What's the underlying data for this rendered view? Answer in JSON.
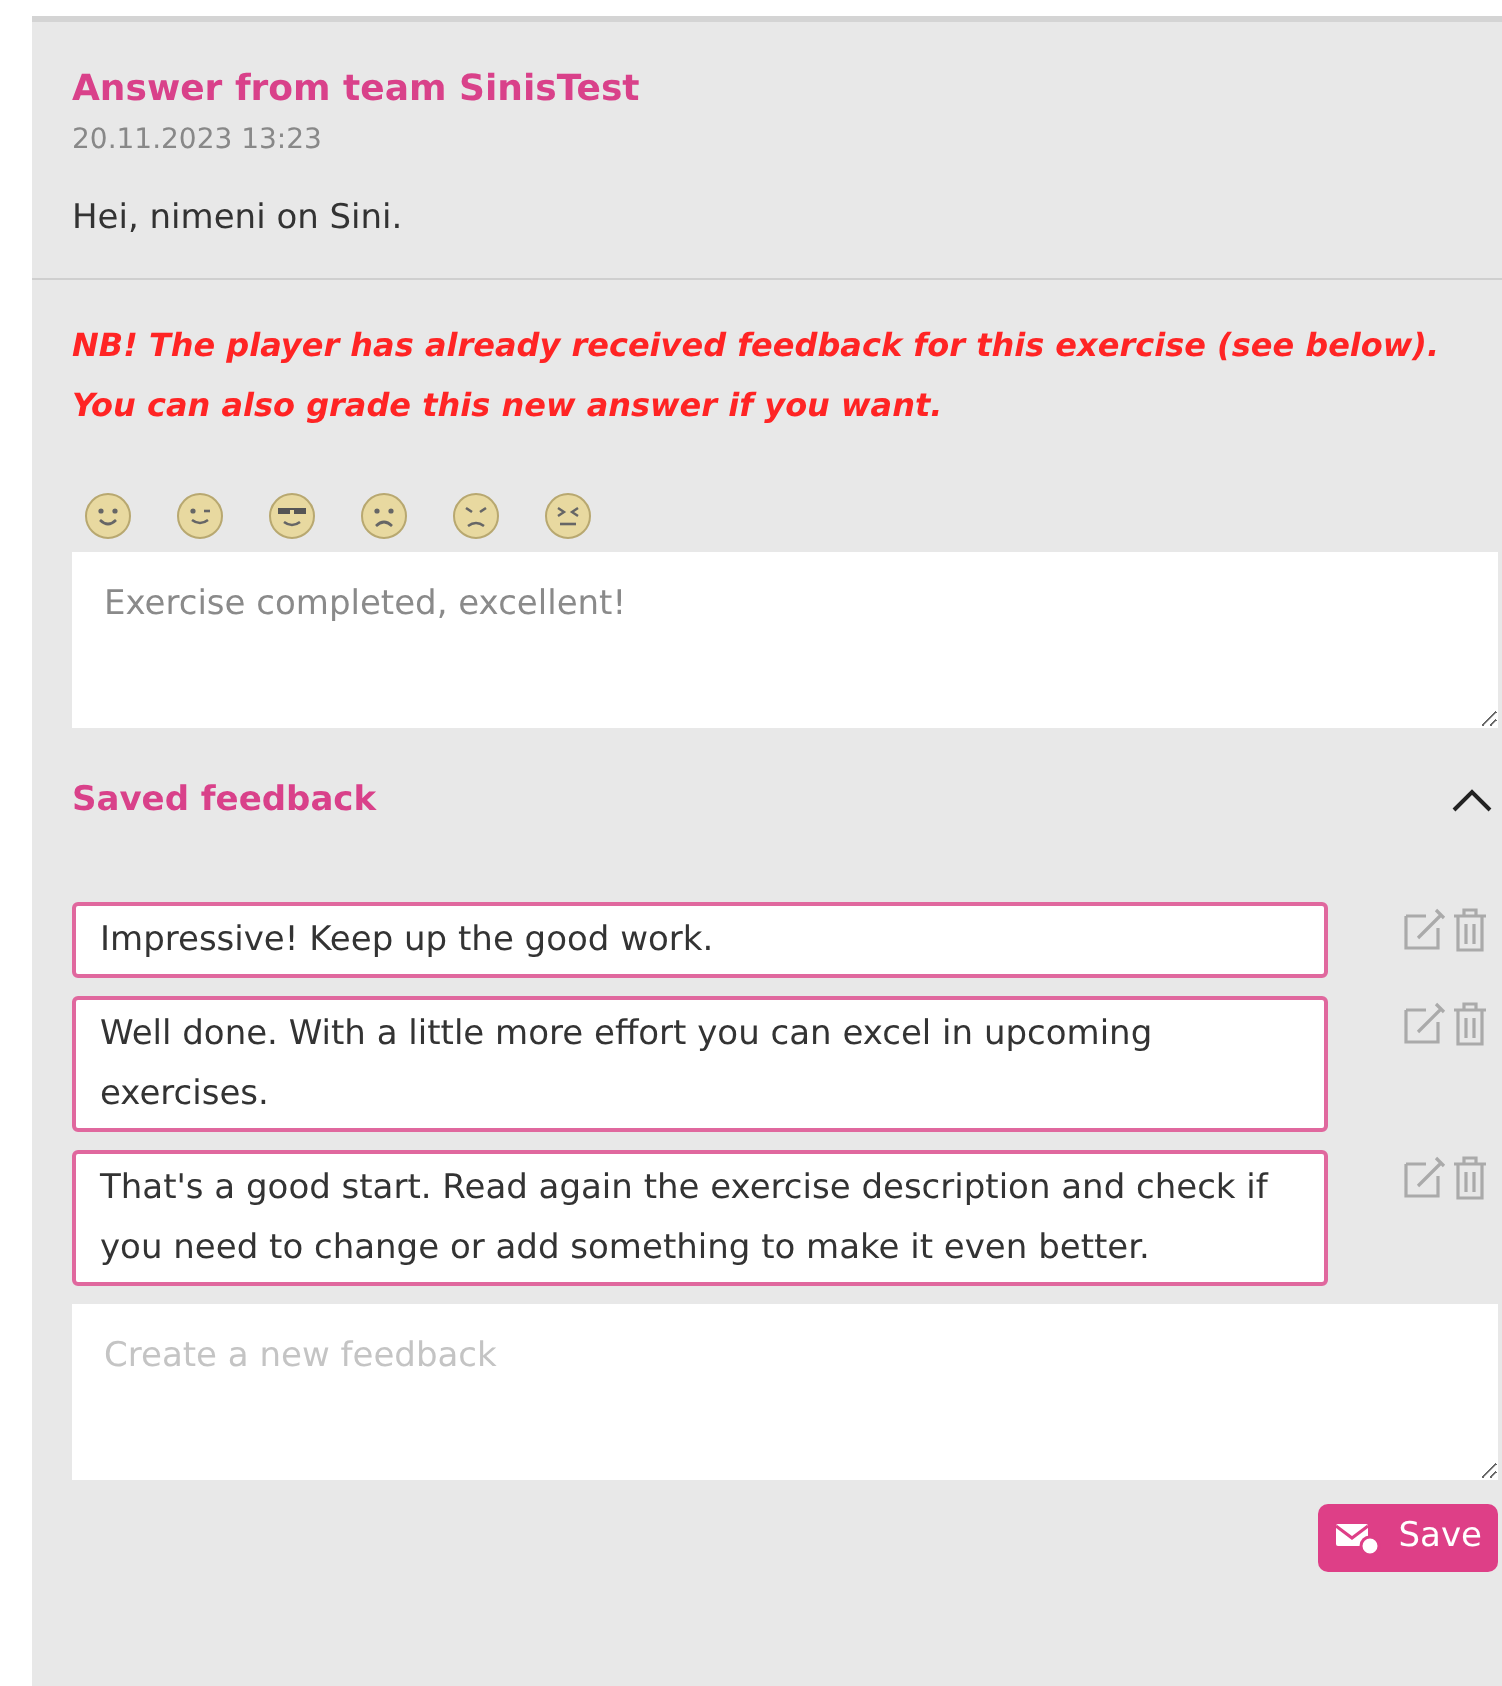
{
  "answer": {
    "title": "Answer from team SinisTest",
    "date": "20.11.2023 13:23",
    "message": "Hei, nimeni on Sini."
  },
  "notice": "NB! The player has already received feedback for this exercise (see below). You can also grade this new answer if you want.",
  "feedback_field": {
    "placeholder": "Exercise completed, excellent!"
  },
  "saved_feedback": {
    "title": "Saved feedback",
    "expanded": true,
    "items": [
      {
        "text": "Impressive! Keep up the good work."
      },
      {
        "text": "Well done. With a little more effort you can excel in upcoming exercises."
      },
      {
        "text": "That's a good start. Read again the exercise description and check if you need to change or add something to make it even better."
      }
    ]
  },
  "new_feedback_field": {
    "placeholder": "Create a new feedback"
  },
  "save_button": "Save"
}
